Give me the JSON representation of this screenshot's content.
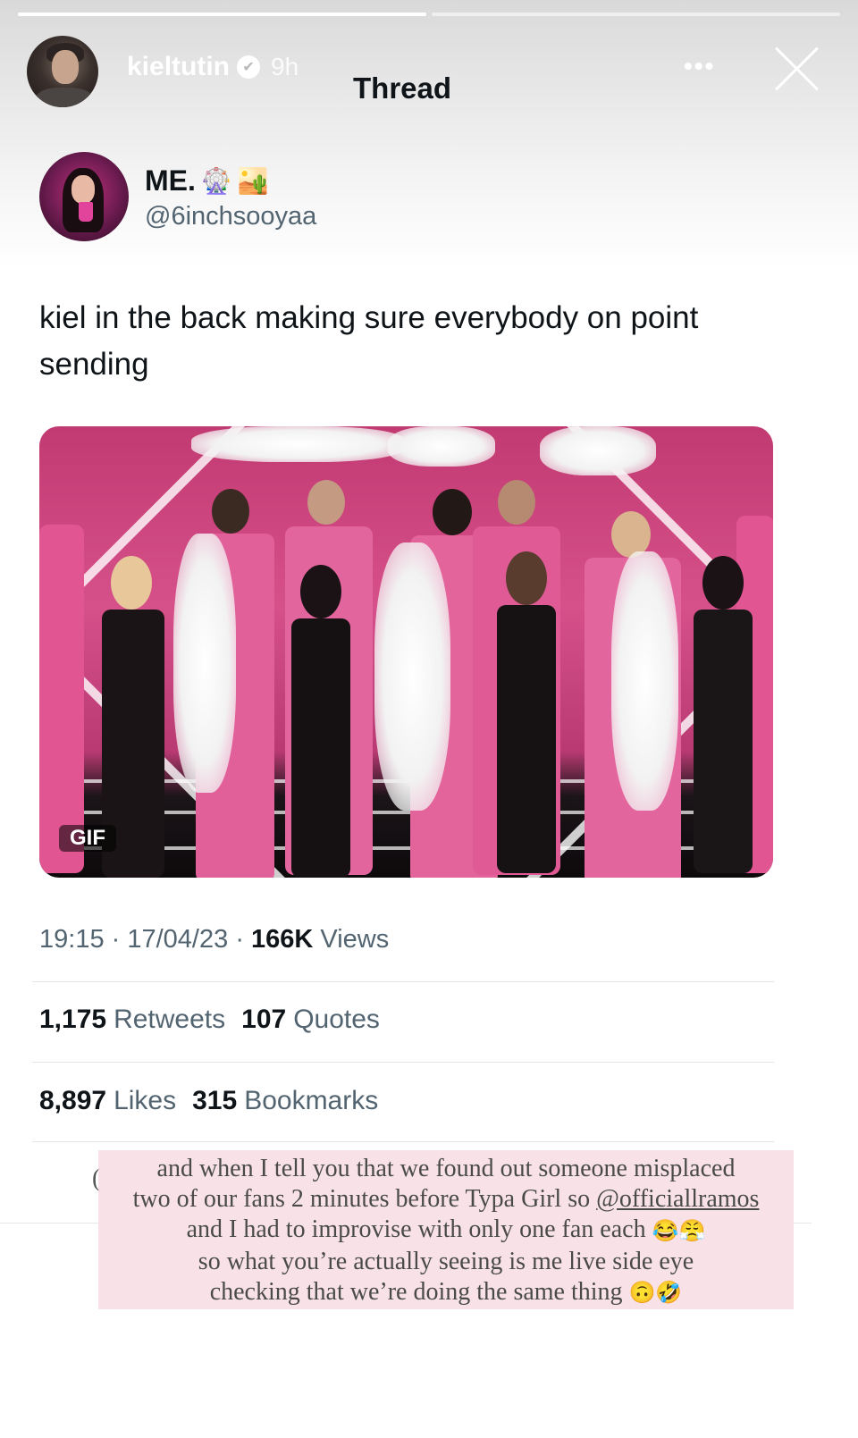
{
  "story": {
    "username": "kieltutin",
    "time": "9h",
    "header_label": "Thread",
    "more_label": "•••",
    "progress": [
      1.0,
      0.0
    ]
  },
  "tweet": {
    "display_name": "ME.",
    "name_emojis": [
      "🎡",
      "🏜️"
    ],
    "handle": "@6inchsooyaa",
    "text": "kiel in the back making sure everybody on point sending",
    "media_badge": "GIF",
    "meta": {
      "time": "19:15",
      "date": "17/04/23",
      "views_count": "166K",
      "views_label": "Views"
    },
    "stats": {
      "retweets_count": "1,175",
      "retweets_label": "Retweets",
      "quotes_count": "107",
      "quotes_label": "Quotes",
      "likes_count": "8,897",
      "likes_label": "Likes",
      "bookmarks_count": "315",
      "bookmarks_label": "Bookmarks"
    }
  },
  "caption": {
    "line1": "and when I tell you that we found out someone misplaced",
    "line2_pre": "two of our fans 2 minutes before Typa Girl so ",
    "line2_mention": "@officiallramos",
    "line3": "and I had to improvise with only one fan each",
    "line3_emojis": "😂😤",
    "line4": "so what you’re actually seeing is me live side eye",
    "line5": "checking that we’re doing the same thing",
    "line5_emojis": "🙃🤣",
    "paren": "("
  },
  "colors": {
    "text_primary": "#0f1419",
    "text_secondary": "#536471",
    "caption_bg": "#f6dce2",
    "stage_pink": "#d6508a"
  }
}
